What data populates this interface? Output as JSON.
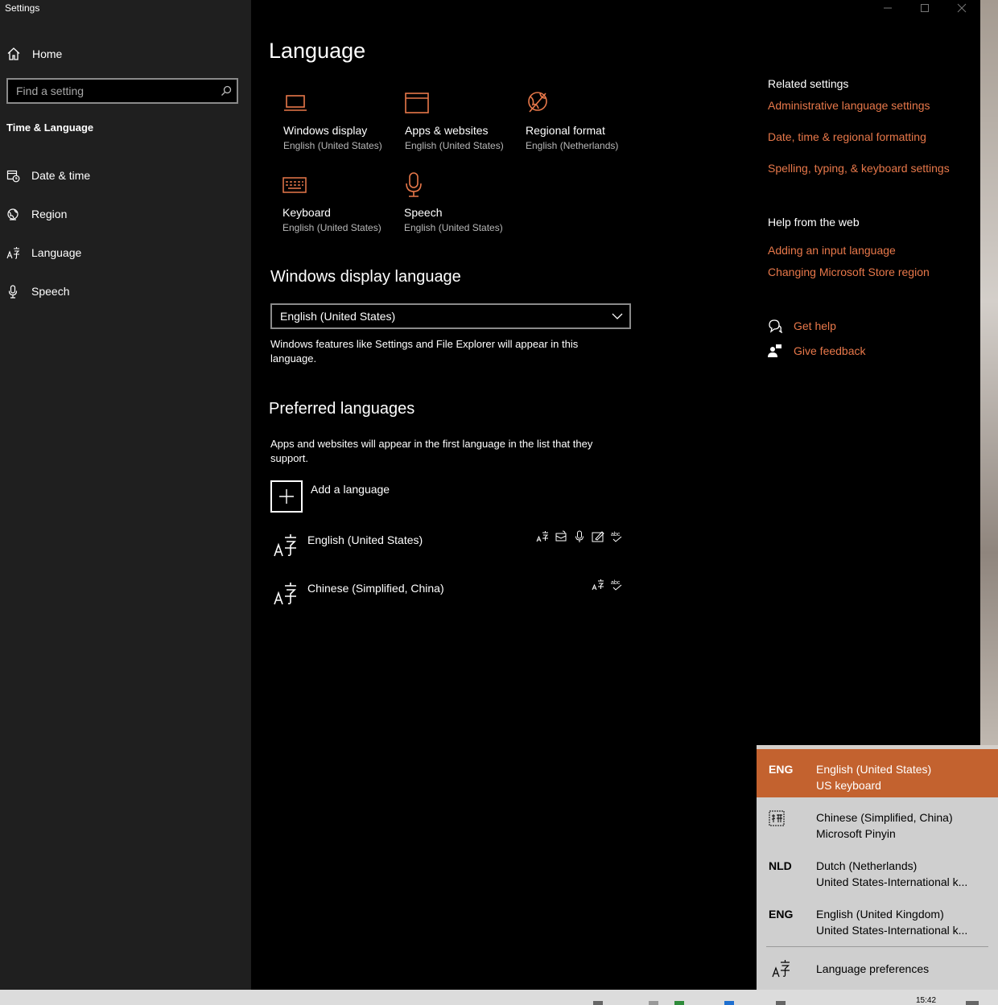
{
  "window": {
    "title": "Settings"
  },
  "sidebar": {
    "home_label": "Home",
    "search_placeholder": "Find a setting",
    "section_title": "Time & Language",
    "items": [
      {
        "label": "Date & time",
        "icon": "date-time-icon"
      },
      {
        "label": "Region",
        "icon": "region-globe-icon"
      },
      {
        "label": "Language",
        "icon": "language-icon"
      },
      {
        "label": "Speech",
        "icon": "microphone-icon"
      }
    ]
  },
  "main": {
    "title": "Language",
    "tiles": [
      {
        "name": "Windows display",
        "sub": "English (United States)",
        "icon": "laptop-icon"
      },
      {
        "name": "Apps & websites",
        "sub": "English (United States)",
        "icon": "browser-window-icon"
      },
      {
        "name": "Regional format",
        "sub": "English (Netherlands)",
        "icon": "globe-icon"
      },
      {
        "name": "Keyboard",
        "sub": "English (United States)",
        "icon": "keyboard-icon"
      },
      {
        "name": "Speech",
        "sub": "English (United States)",
        "icon": "microphone-icon"
      }
    ],
    "display_language": {
      "heading": "Windows display language",
      "selected": "English (United States)",
      "description": "Windows features like Settings and File Explorer will appear in this language."
    },
    "preferred": {
      "heading": "Preferred languages",
      "description": "Apps and websites will appear in the first language in the list that they support.",
      "add_label": "Add a language",
      "languages": [
        {
          "name": "English (United States)",
          "features": [
            "display-language-icon",
            "text-to-speech-icon",
            "speech-recognition-icon",
            "handwriting-icon",
            "spell-check-icon"
          ]
        },
        {
          "name": "Chinese (Simplified, China)",
          "features": [
            "display-language-icon",
            "spell-check-icon"
          ]
        }
      ]
    }
  },
  "related": {
    "title": "Related settings",
    "links": [
      "Administrative language settings",
      "Date, time & regional formatting",
      "Spelling, typing, & keyboard settings"
    ],
    "help_title": "Help from the web",
    "help_links": [
      "Adding an input language",
      "Changing Microsoft Store region"
    ],
    "get_help": "Get help",
    "give_feedback": "Give feedback"
  },
  "input_popup": {
    "items": [
      {
        "code": "ENG",
        "line1": "English (United States)",
        "line2": "US keyboard",
        "selected": true
      },
      {
        "code": "",
        "icon": "pinyin-icon",
        "line1": "Chinese (Simplified, China)",
        "line2": "Microsoft Pinyin",
        "selected": false
      },
      {
        "code": "NLD",
        "line1": "Dutch (Netherlands)",
        "line2": "United States-International k...",
        "selected": false
      },
      {
        "code": "ENG",
        "line1": "English (United Kingdom)",
        "line2": "United States-International k...",
        "selected": false
      }
    ],
    "prefs_label": "Language preferences"
  },
  "taskbar": {
    "time": "15:42"
  },
  "colors": {
    "accent": "#e8784a",
    "selected": "#c3622f",
    "sidebar": "#1f1f1f",
    "background": "#000000"
  }
}
